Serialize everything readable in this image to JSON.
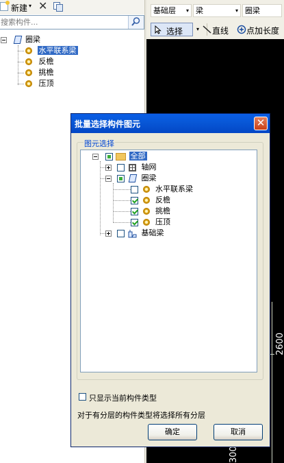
{
  "left_panel": {
    "toolbar": {
      "new_label": "新建",
      "new_arrow": "▾",
      "delete_glyph": "✕"
    },
    "search": {
      "placeholder": "搜索构件..."
    },
    "tree": {
      "root": "圈梁",
      "children": [
        "水平联系梁",
        "反檐",
        "挑檐",
        "压顶"
      ],
      "selected": "水平联系梁"
    }
  },
  "right_panel": {
    "combo_floor": "基础层",
    "combo_type": "梁",
    "combo_member": "圈梁",
    "combo_arrow": "▾",
    "select_label": "选择",
    "line_label": "直线",
    "add_length_label": "点加长度",
    "dim_text_1": "2600",
    "dim_text_2": "300"
  },
  "dialog": {
    "title": "批量选择构件图元",
    "close_glyph": "✕",
    "group_label": "图元选择",
    "tree": {
      "all": "全部",
      "axis": "轴网",
      "ring_beam": "圈梁",
      "ring_children": [
        {
          "label": "水平联系梁",
          "checked": false
        },
        {
          "label": "反檐",
          "checked": true
        },
        {
          "label": "挑檐",
          "checked": true
        },
        {
          "label": "压顶",
          "checked": true
        }
      ],
      "foundation_beam": "基础梁"
    },
    "only_current_label": "只显示当前构件类型",
    "info": "对于有分层的构件类型将选择所有分层",
    "ok": "确定",
    "cancel": "取消"
  }
}
